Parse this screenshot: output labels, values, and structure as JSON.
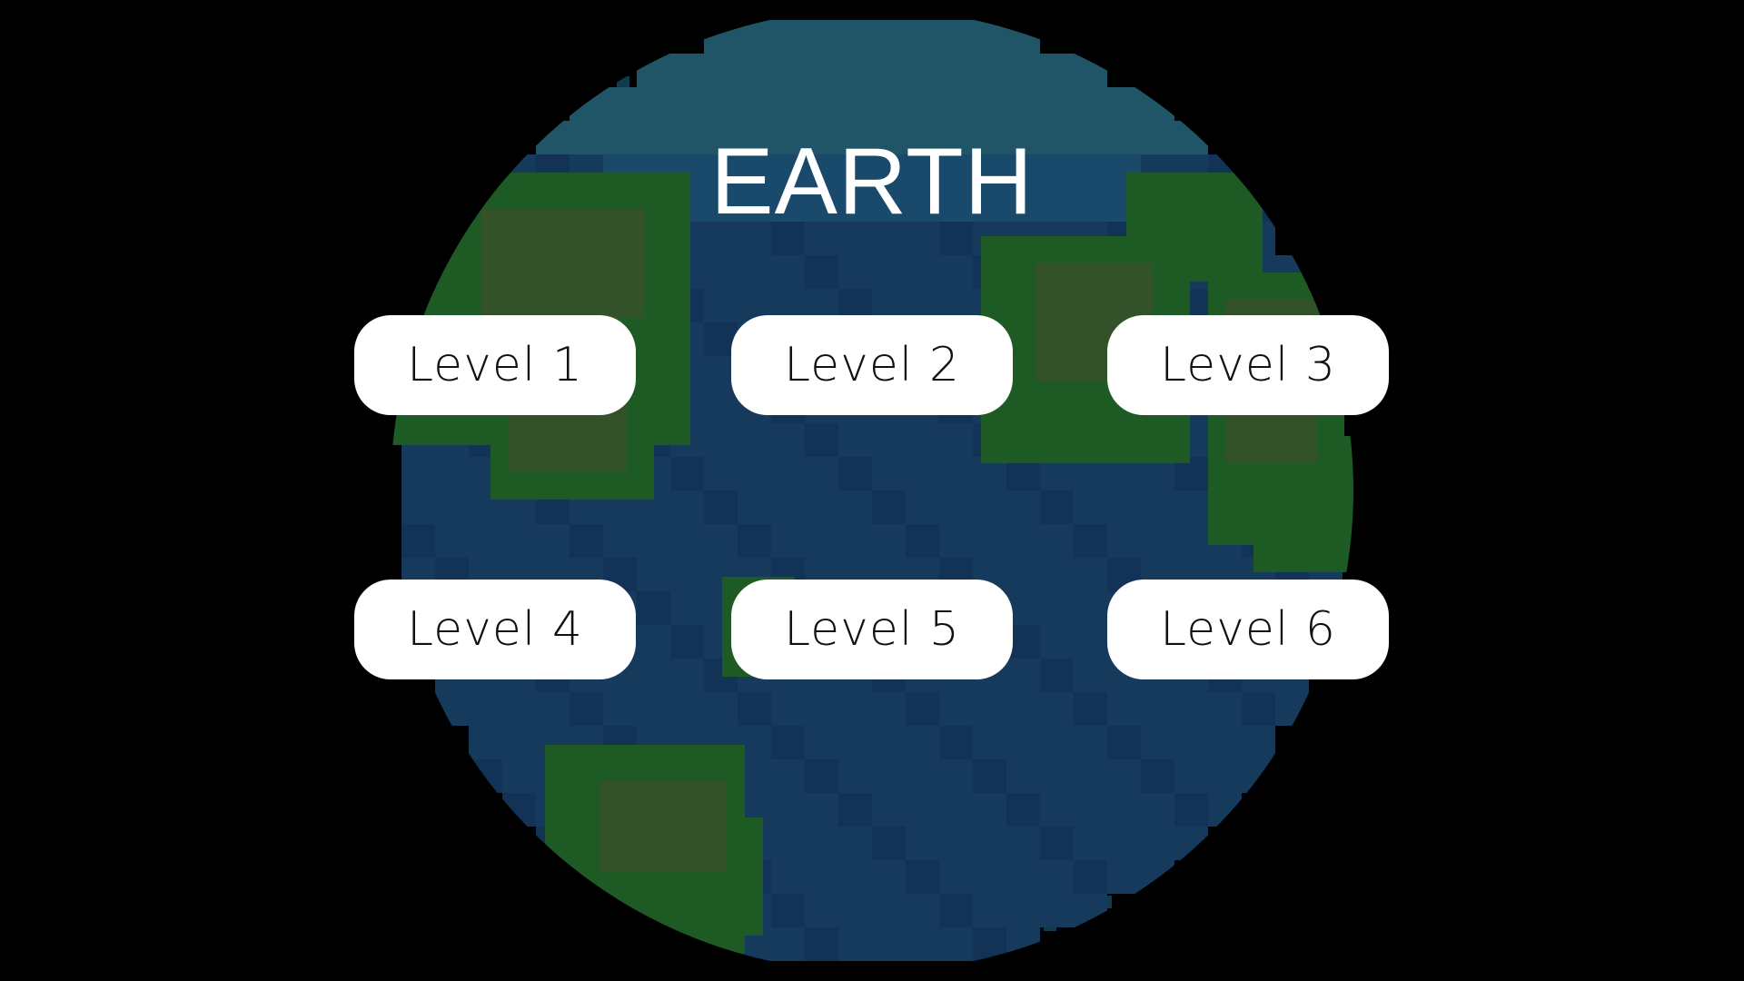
{
  "planet": {
    "title": "EARTH"
  },
  "levels": [
    {
      "label": "Level 1"
    },
    {
      "label": "Level 2"
    },
    {
      "label": "Level 3"
    },
    {
      "label": "Level 4"
    },
    {
      "label": "Level 5"
    },
    {
      "label": "Level 6"
    }
  ],
  "colors": {
    "background": "#000000",
    "ocean": "#153a5c",
    "ocean_dark": "#123355",
    "ocean_light": "#1a4a6b",
    "ice": "#1f5566",
    "land": "#1e5a24",
    "land_light": "#34522a",
    "star": "#0e3c4d",
    "button_bg": "#ffffff",
    "button_text": "#111111",
    "title_text": "#ffffff"
  }
}
